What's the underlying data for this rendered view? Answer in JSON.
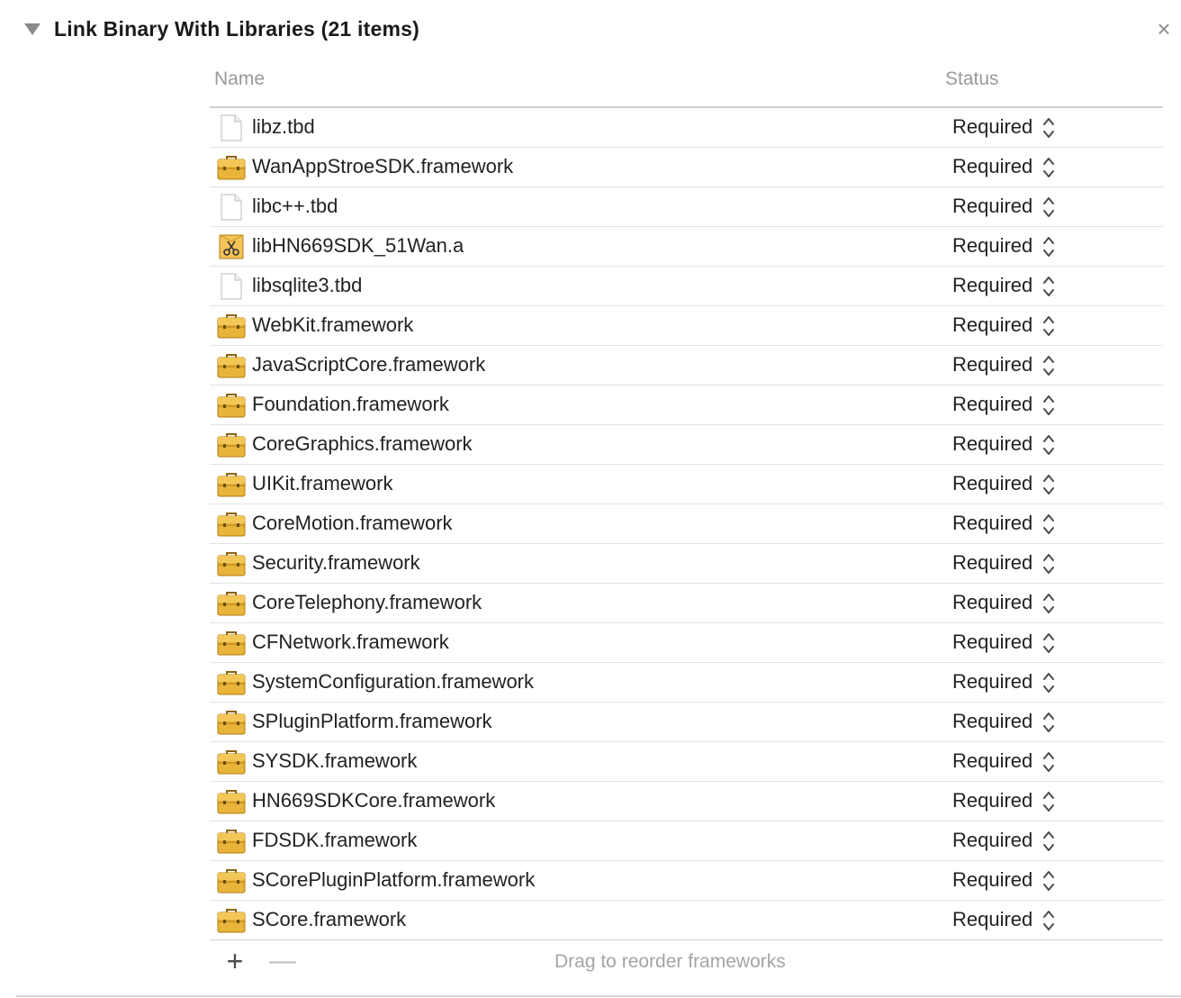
{
  "phase": {
    "title": "Link Binary With Libraries (21 items)",
    "disclosure_icon": "disclosure-triangle-down-icon",
    "close_icon": "close-icon",
    "close_glyph": "×"
  },
  "columns": {
    "name": "Name",
    "status": "Status"
  },
  "libraries": [
    {
      "name": "libz.tbd",
      "status": "Required",
      "icon": "document-icon"
    },
    {
      "name": "WanAppStroeSDK.framework",
      "status": "Required",
      "icon": "framework-toolbox-icon"
    },
    {
      "name": "libc++.tbd",
      "status": "Required",
      "icon": "document-icon"
    },
    {
      "name": "libHN669SDK_51Wan.a",
      "status": "Required",
      "icon": "static-library-icon"
    },
    {
      "name": "libsqlite3.tbd",
      "status": "Required",
      "icon": "document-icon"
    },
    {
      "name": "WebKit.framework",
      "status": "Required",
      "icon": "framework-toolbox-icon"
    },
    {
      "name": "JavaScriptCore.framework",
      "status": "Required",
      "icon": "framework-toolbox-icon"
    },
    {
      "name": "Foundation.framework",
      "status": "Required",
      "icon": "framework-toolbox-icon"
    },
    {
      "name": "CoreGraphics.framework",
      "status": "Required",
      "icon": "framework-toolbox-icon"
    },
    {
      "name": "UIKit.framework",
      "status": "Required",
      "icon": "framework-toolbox-icon"
    },
    {
      "name": "CoreMotion.framework",
      "status": "Required",
      "icon": "framework-toolbox-icon"
    },
    {
      "name": "Security.framework",
      "status": "Required",
      "icon": "framework-toolbox-icon"
    },
    {
      "name": "CoreTelephony.framework",
      "status": "Required",
      "icon": "framework-toolbox-icon"
    },
    {
      "name": "CFNetwork.framework",
      "status": "Required",
      "icon": "framework-toolbox-icon"
    },
    {
      "name": "SystemConfiguration.framework",
      "status": "Required",
      "icon": "framework-toolbox-icon"
    },
    {
      "name": "SPluginPlatform.framework",
      "status": "Required",
      "icon": "framework-toolbox-icon"
    },
    {
      "name": "SYSDK.framework",
      "status": "Required",
      "icon": "framework-toolbox-icon"
    },
    {
      "name": "HN669SDKCore.framework",
      "status": "Required",
      "icon": "framework-toolbox-icon"
    },
    {
      "name": "FDSDK.framework",
      "status": "Required",
      "icon": "framework-toolbox-icon"
    },
    {
      "name": "SCorePluginPlatform.framework",
      "status": "Required",
      "icon": "framework-toolbox-icon"
    },
    {
      "name": "SCore.framework",
      "status": "Required",
      "icon": "framework-toolbox-icon"
    }
  ],
  "footer": {
    "add_glyph": "+",
    "remove_glyph": "—",
    "hint": "Drag to reorder frameworks"
  },
  "colors": {
    "framework_gold": "#e8b43a",
    "framework_dark": "#b07d12",
    "header_text": "#9a9a9a",
    "hint_text": "#a5a5a5"
  }
}
